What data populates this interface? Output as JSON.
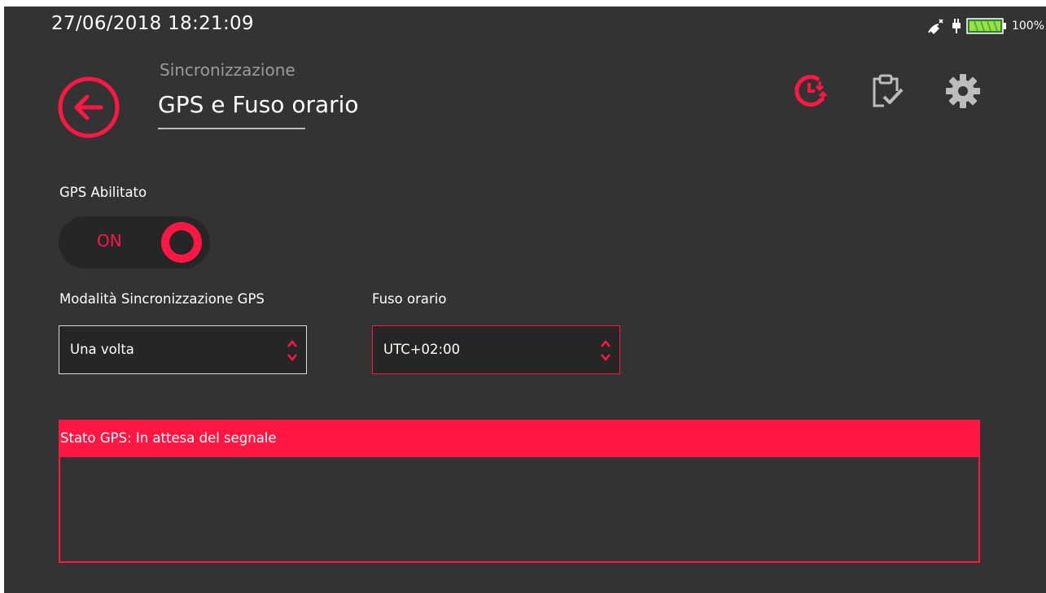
{
  "status_bar": {
    "datetime": "27/06/2018  18:21:09",
    "battery_percent": "100%",
    "icons": [
      "satellite-off-icon",
      "charging-plug-icon",
      "battery-icon"
    ]
  },
  "header": {
    "subtitle": "Sincronizzazione",
    "title": "GPS e Fuso orario",
    "actions": [
      "clock-sync-icon",
      "clipboard-check-icon",
      "gear-icon"
    ]
  },
  "gps_enabled": {
    "label": "GPS Abilitato",
    "state": "ON"
  },
  "sync_mode": {
    "label": "Modalità Sincronizzazione GPS",
    "value": "Una volta"
  },
  "timezone": {
    "label": "Fuso orario",
    "value": "UTC+02:00"
  },
  "gps_status": {
    "header": "Stato GPS: In attesa del segnale"
  },
  "colors": {
    "accent": "#ff1744",
    "background": "#333333",
    "control_background": "#262626"
  }
}
